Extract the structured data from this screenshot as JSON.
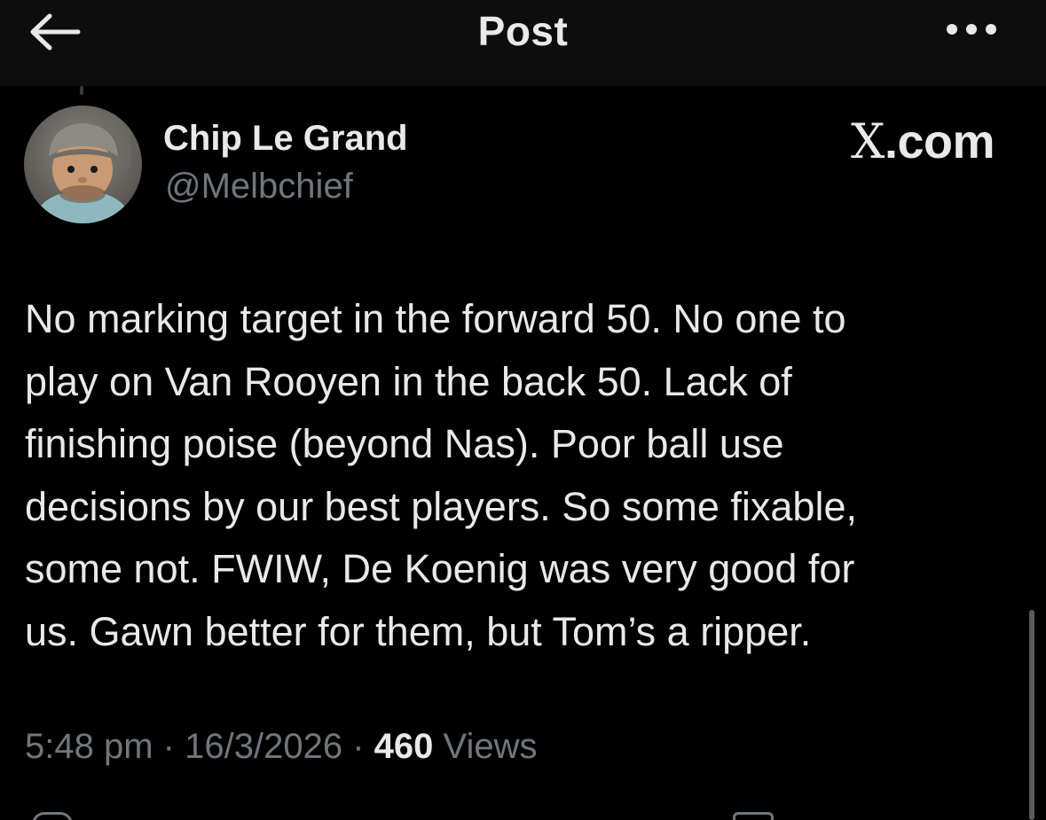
{
  "header": {
    "title": "Post",
    "back_icon": "back-arrow-icon",
    "more_icon": "more-dots-icon"
  },
  "author": {
    "display_name": "Chip Le Grand",
    "handle": "@Melbchief"
  },
  "watermark": {
    "x_letter": "X",
    "suffix": ".com"
  },
  "post": {
    "text": "No marking target in the forward 50. No one to\nplay on Van Rooyen in the back 50. Lack of\nfinishing poise (beyond Nas). Poor ball use\ndecisions by our best players. So some fixable,\nsome not. FWIW, De Koenig was very good for\nus. Gawn better for them, but Tom’s a ripper."
  },
  "meta": {
    "time": "5:48 pm",
    "separator": "·",
    "date": "16/3/2026",
    "views_count": "460",
    "views_label": "Views"
  },
  "colors": {
    "background": "#000000",
    "header_bg": "#0d0d0d",
    "primary_text": "#e7e9ea",
    "secondary_text": "#71767b"
  }
}
